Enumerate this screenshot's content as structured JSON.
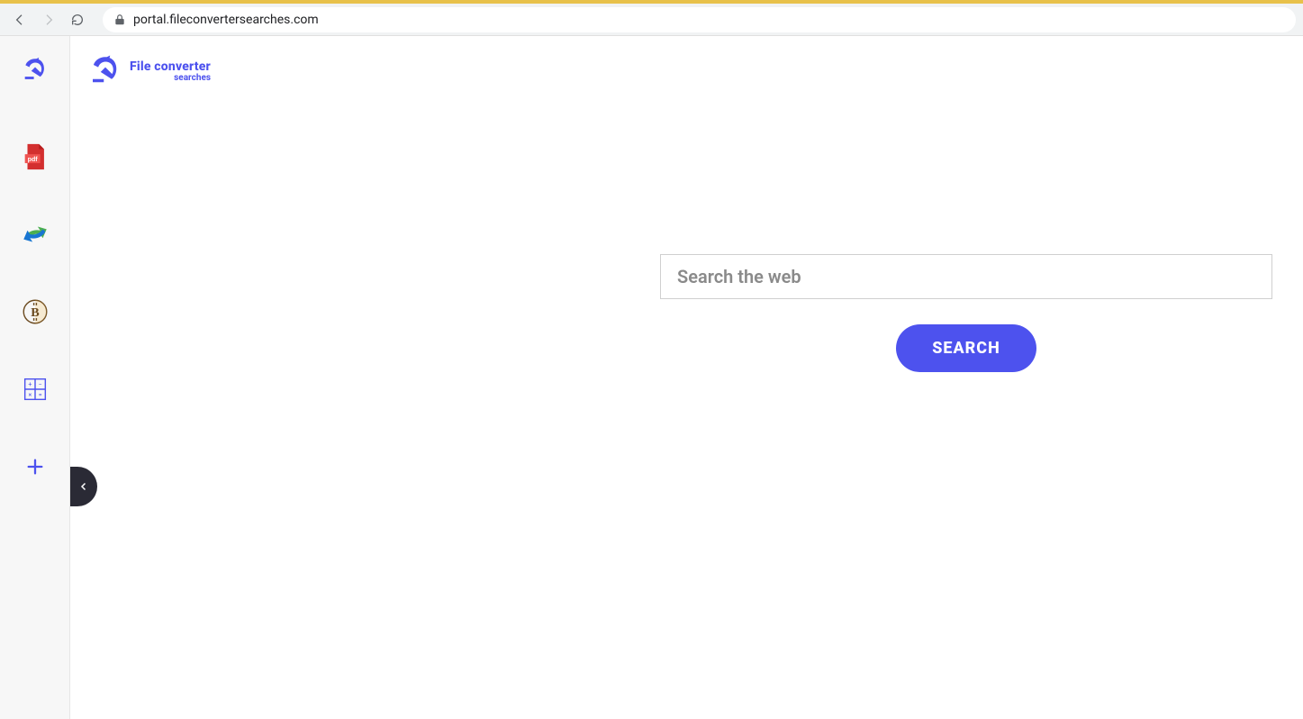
{
  "browser": {
    "url": "portal.fileconvertersearches.com"
  },
  "brand": {
    "line1": "File converter",
    "line2": "searches"
  },
  "search": {
    "placeholder": "Search the web",
    "button_label": "SEARCH"
  },
  "sidebar": {
    "items": [
      {
        "name": "logo"
      },
      {
        "name": "pdf"
      },
      {
        "name": "convert"
      },
      {
        "name": "crypto"
      },
      {
        "name": "calculator"
      },
      {
        "name": "add"
      }
    ]
  },
  "colors": {
    "accent": "#4d52ee",
    "gold": "#e8c14a"
  }
}
